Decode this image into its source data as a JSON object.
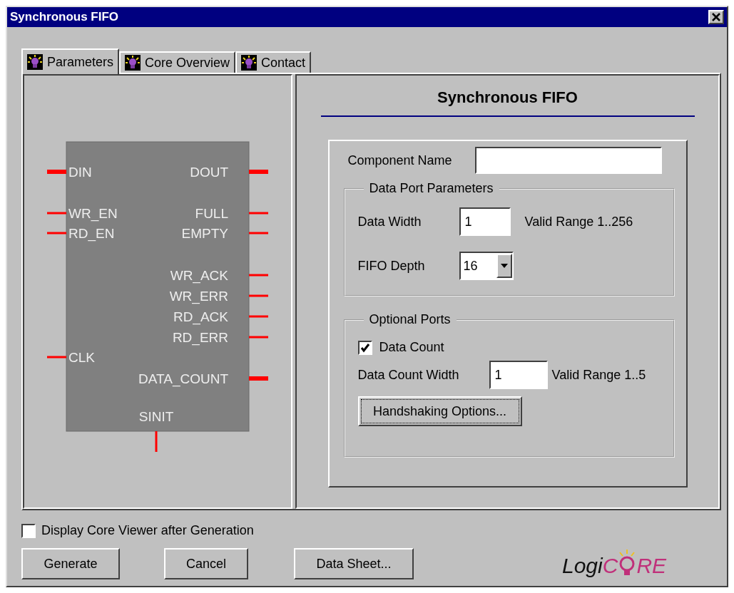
{
  "window": {
    "title": "Synchronous FIFO"
  },
  "tabs": [
    {
      "label": "Parameters",
      "selected": true
    },
    {
      "label": "Core Overview",
      "selected": false
    },
    {
      "label": "Contact",
      "selected": false
    }
  ],
  "symbol": {
    "pins": [
      {
        "name": "DIN",
        "kind": "left",
        "bus": true
      },
      {
        "name": "WR_EN",
        "kind": "left",
        "bus": false
      },
      {
        "name": "RD_EN",
        "kind": "left",
        "bus": false
      },
      {
        "name": "CLK",
        "kind": "left",
        "bus": false
      },
      {
        "name": "DOUT",
        "kind": "right",
        "bus": true
      },
      {
        "name": "FULL",
        "kind": "right",
        "bus": false
      },
      {
        "name": "EMPTY",
        "kind": "right",
        "bus": false
      },
      {
        "name": "WR_ACK",
        "kind": "right",
        "bus": false
      },
      {
        "name": "WR_ERR",
        "kind": "right",
        "bus": false
      },
      {
        "name": "RD_ACK",
        "kind": "right",
        "bus": false
      },
      {
        "name": "RD_ERR",
        "kind": "right",
        "bus": false
      },
      {
        "name": "DATA_COUNT",
        "kind": "right",
        "bus": true
      },
      {
        "name": "SINIT",
        "kind": "bottom",
        "bus": false
      }
    ]
  },
  "form": {
    "title": "Synchronous FIFO",
    "component_name": {
      "label": "Component Name"
    },
    "data_port_parameters": {
      "legend": "Data Port Parameters",
      "data_width": {
        "label": "Data Width",
        "value": "1",
        "hint": "Valid Range 1..256"
      },
      "fifo_depth": {
        "label": "FIFO Depth",
        "value": "16"
      }
    },
    "optional_ports": {
      "legend": "Optional Ports",
      "data_count": {
        "label": "Data Count",
        "checked": true
      },
      "data_count_width": {
        "label": "Data Count Width",
        "value": "1",
        "hint": "Valid Range 1..5"
      },
      "button": {
        "label": "Handshaking Options...",
        "focused": true
      }
    }
  },
  "display_viewer": {
    "label": "Display Core Viewer after Generation",
    "checked": false
  },
  "buttons": [
    "Generate",
    "Cancel",
    "Data Sheet..."
  ],
  "logo": {
    "parts": [
      "Logi",
      "C",
      "RE"
    ]
  }
}
